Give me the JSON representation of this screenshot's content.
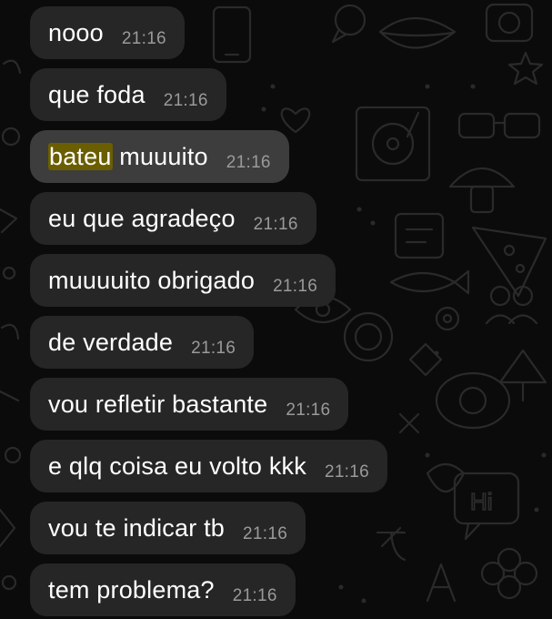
{
  "chat": {
    "messages": [
      {
        "text": "nooo",
        "highlight": "",
        "time": "21:16"
      },
      {
        "text": "que foda",
        "highlight": "",
        "time": "21:16"
      },
      {
        "text": " muuuito",
        "highlight": "bateu",
        "time": "21:16"
      },
      {
        "text": "eu que agradeço",
        "highlight": "",
        "time": "21:16"
      },
      {
        "text": "muuuuito obrigado",
        "highlight": "",
        "time": "21:16"
      },
      {
        "text": "de verdade",
        "highlight": "",
        "time": "21:16"
      },
      {
        "text": "vou refletir bastante",
        "highlight": "",
        "time": "21:16"
      },
      {
        "text": "e qlq coisa eu volto kkk",
        "highlight": "",
        "time": "21:16"
      },
      {
        "text": "vou te indicar tb",
        "highlight": "",
        "time": "21:16"
      },
      {
        "text": "tem problema?",
        "highlight": "",
        "time": "21:16"
      }
    ]
  },
  "background": {
    "doodle_text": "Hi"
  },
  "colors": {
    "background": "#0b0b0b",
    "bubble": "#262626",
    "bubble_selected": "#3d3d3d",
    "search_highlight": "#6a5e00",
    "message_text": "#ffffff",
    "timestamp_text": "#9a9a9a",
    "doodle_stroke": "#2a2a2a"
  }
}
